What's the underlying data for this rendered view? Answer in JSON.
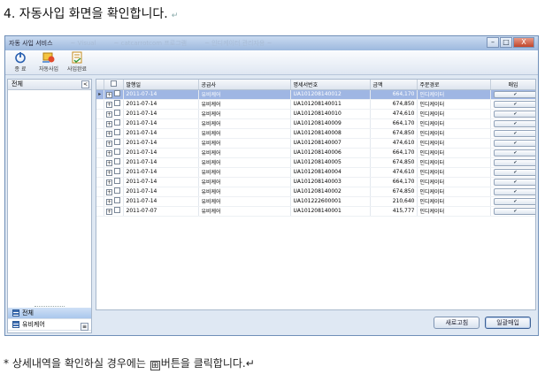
{
  "doc": {
    "heading": "4. 자동사입 화면을 확인합니다.",
    "para_mark": "↵",
    "note_prefix": "* 상세내역을 확인하실 경우에는 ",
    "note_icon": "⊞",
    "note_suffix": "버튼을 클릭합니다.↵"
  },
  "window": {
    "title": "자동 사입 서비스",
    "blurred_tabs": [
      "~ Visual",
      "~ catcarrotcom 프로그램",
      "~ 인디케이터 관리자용 ~"
    ],
    "minimize": "–",
    "maximize": "□",
    "close": "X"
  },
  "toolbar": {
    "items": [
      {
        "label": "종 료",
        "icon": "power-icon"
      },
      {
        "label": "자동사입",
        "icon": "auto-purchase-icon"
      },
      {
        "label": "사입완료",
        "icon": "purchase-complete-icon"
      }
    ]
  },
  "left_panel": {
    "header": "전체",
    "collapse": "<",
    "nav": [
      {
        "label": "전체",
        "selected": true
      },
      {
        "label": "유비케어",
        "selected": false
      }
    ],
    "more": "≡"
  },
  "grid": {
    "columns": [
      "",
      "",
      "발행일",
      "공급사",
      "명세서번호",
      "금액",
      "주문경로",
      "매입"
    ],
    "approve_label": "✔",
    "rows": [
      {
        "date": "2011-07-14",
        "supplier": "유비케어",
        "invoice": "UA101208140012",
        "amount": "664,170",
        "route": "인디케이터",
        "selected": true
      },
      {
        "date": "2011-07-14",
        "supplier": "유비케어",
        "invoice": "UA101208140011",
        "amount": "674,850",
        "route": "인디케이터"
      },
      {
        "date": "2011-07-14",
        "supplier": "유비케어",
        "invoice": "UA101208140010",
        "amount": "474,610",
        "route": "인디케이터"
      },
      {
        "date": "2011-07-14",
        "supplier": "유비케어",
        "invoice": "UA101208140009",
        "amount": "664,170",
        "route": "인디케이터"
      },
      {
        "date": "2011-07-14",
        "supplier": "유비케어",
        "invoice": "UA101208140008",
        "amount": "674,850",
        "route": "인디케이터"
      },
      {
        "date": "2011-07-14",
        "supplier": "유비케어",
        "invoice": "UA101208140007",
        "amount": "474,610",
        "route": "인디케이터"
      },
      {
        "date": "2011-07-14",
        "supplier": "유비케어",
        "invoice": "UA101208140006",
        "amount": "664,170",
        "route": "인디케이터"
      },
      {
        "date": "2011-07-14",
        "supplier": "유비케어",
        "invoice": "UA101208140005",
        "amount": "674,850",
        "route": "인디케이터"
      },
      {
        "date": "2011-07-14",
        "supplier": "유비케어",
        "invoice": "UA101208140004",
        "amount": "474,610",
        "route": "인디케이터"
      },
      {
        "date": "2011-07-14",
        "supplier": "유비케어",
        "invoice": "UA101208140003",
        "amount": "664,170",
        "route": "인디케이터"
      },
      {
        "date": "2011-07-14",
        "supplier": "유비케어",
        "invoice": "UA101208140002",
        "amount": "674,850",
        "route": "인디케이터"
      },
      {
        "date": "2011-07-14",
        "supplier": "유비케어",
        "invoice": "UA101222600001",
        "amount": "210,640",
        "route": "인디케이터"
      },
      {
        "date": "2011-07-07",
        "supplier": "유비케어",
        "invoice": "UA101208140001",
        "amount": "415,777",
        "route": "인디케이터"
      }
    ]
  },
  "buttons": {
    "refresh": "새로고침",
    "bulk_purchase": "일괄매입"
  },
  "colors": {
    "selected_row": "#9fb6e3",
    "window_border": "#6f8fb8",
    "close_button": "#c1462b"
  }
}
